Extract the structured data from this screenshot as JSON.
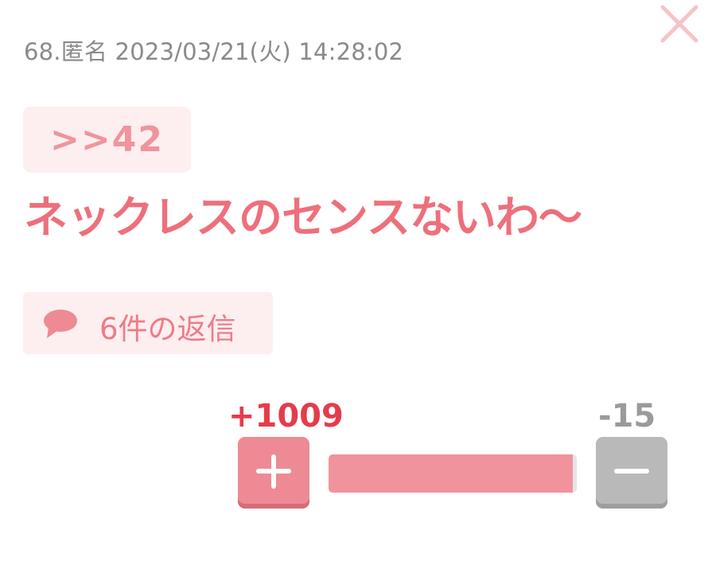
{
  "post": {
    "header": "68.匿名 2023/03/21(火) 14:28:02",
    "anchor": ">>42",
    "body": "ネックレスのセンスないわ〜"
  },
  "replies": {
    "label": "6件の返信",
    "icon": "speech-bubble-icon"
  },
  "votes": {
    "plus_label": "+1009",
    "minus_label": "-15",
    "plus": 1009,
    "minus": 15,
    "plus_icon": "plus-icon",
    "minus_icon": "minus-icon"
  },
  "controls": {
    "close_icon": "close-icon"
  },
  "colors": {
    "accent_text": "#ee6f7c",
    "chip_bg": "#fdeef0",
    "plus_count": "#e43c4c",
    "bar_fill": "#f0939c",
    "minus_button": "#b9b9b9"
  }
}
